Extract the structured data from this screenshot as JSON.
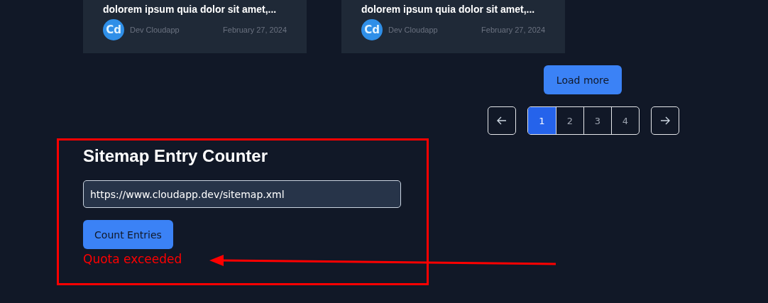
{
  "posts": [
    {
      "title": "dolorem ipsum quia dolor sit amet,...",
      "avatar": "Cd",
      "author": "Dev Cloudapp",
      "date": "February 27, 2024"
    },
    {
      "title": "dolorem ipsum quia dolor sit amet,...",
      "avatar": "Cd",
      "author": "Dev Cloudapp",
      "date": "February 27, 2024"
    }
  ],
  "load_more": "Load more",
  "pagination": {
    "pages": [
      {
        "label": "1",
        "selected": true
      },
      {
        "label": "2",
        "selected": false
      },
      {
        "label": "3",
        "selected": false
      },
      {
        "label": "4",
        "selected": false
      }
    ]
  },
  "counter": {
    "title": "Sitemap Entry Counter",
    "url": "https://www.cloudapp.dev/sitemap.xml",
    "button": "Count Entries",
    "error": "Quota exceeded"
  }
}
